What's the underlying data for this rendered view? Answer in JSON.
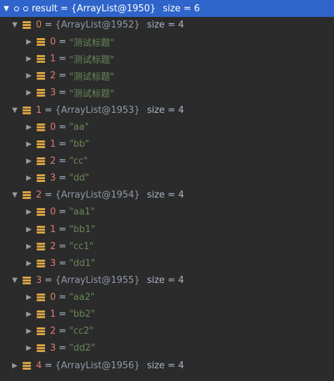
{
  "root": {
    "name": "result",
    "type": "{ArrayList@1950}",
    "size": "size = 6",
    "arrow": "▼"
  },
  "lists": [
    {
      "name": "0",
      "type": "{ArrayList@1952}",
      "size": "size = 4",
      "arrow": "▼",
      "items": [
        {
          "name": "0",
          "value": "\"测试标题\""
        },
        {
          "name": "1",
          "value": "\"测试标题\""
        },
        {
          "name": "2",
          "value": "\"测试标题\""
        },
        {
          "name": "3",
          "value": "\"测试标题\""
        }
      ]
    },
    {
      "name": "1",
      "type": "{ArrayList@1953}",
      "size": "size = 4",
      "arrow": "▼",
      "items": [
        {
          "name": "0",
          "value": "\"aa\""
        },
        {
          "name": "1",
          "value": "\"bb\""
        },
        {
          "name": "2",
          "value": "\"cc\""
        },
        {
          "name": "3",
          "value": "\"dd\""
        }
      ]
    },
    {
      "name": "2",
      "type": "{ArrayList@1954}",
      "size": "size = 4",
      "arrow": "▼",
      "items": [
        {
          "name": "0",
          "value": "\"aa1\""
        },
        {
          "name": "1",
          "value": "\"bb1\""
        },
        {
          "name": "2",
          "value": "\"cc1\""
        },
        {
          "name": "3",
          "value": "\"dd1\""
        }
      ]
    },
    {
      "name": "3",
      "type": "{ArrayList@1955}",
      "size": "size = 4",
      "arrow": "▼",
      "items": [
        {
          "name": "0",
          "value": "\"aa2\""
        },
        {
          "name": "1",
          "value": "\"bb2\""
        },
        {
          "name": "2",
          "value": "\"cc2\""
        },
        {
          "name": "3",
          "value": "\"dd2\""
        }
      ]
    },
    {
      "name": "4",
      "type": "{ArrayList@1956}",
      "size": "size = 4",
      "arrow": "▶",
      "items": []
    }
  ],
  "item_arrow": "▶",
  "eq_sign": "=",
  "colors": {
    "background": "#2b2b2b",
    "selection": "#2f65ca",
    "name": "#e07a6a",
    "string": "#6a8759",
    "type": "#8f9aa7",
    "list_icon": "#d9a343"
  }
}
